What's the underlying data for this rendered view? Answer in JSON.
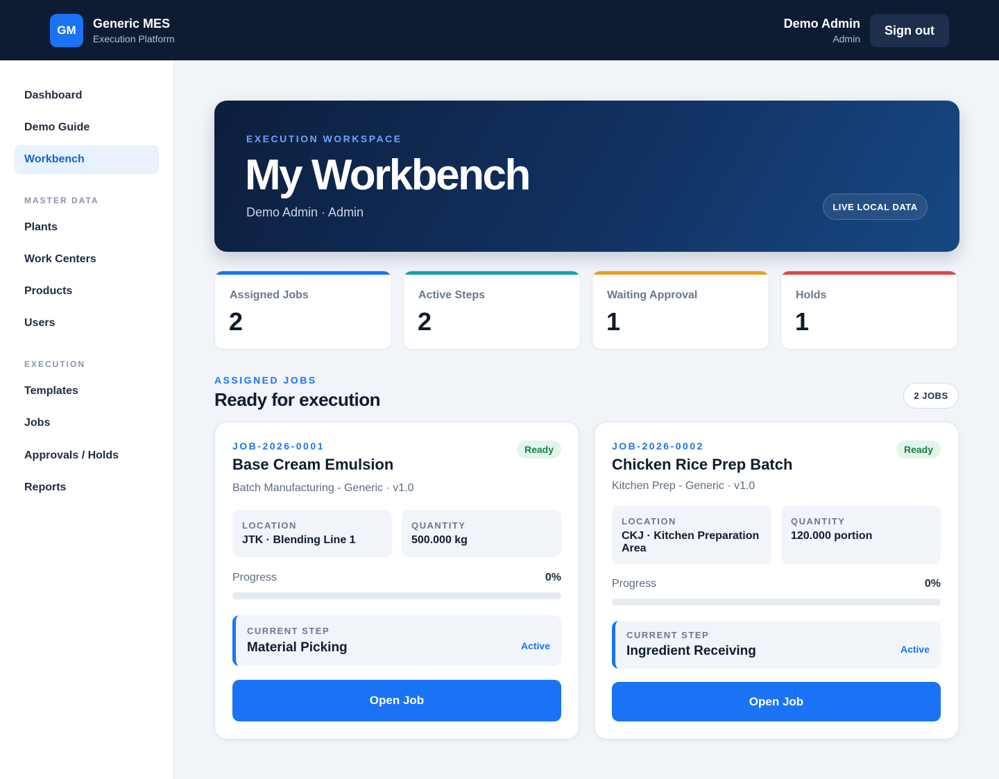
{
  "header": {
    "logo_text": "GM",
    "app_name": "Generic MES",
    "app_subtitle": "Execution Platform",
    "user_name": "Demo Admin",
    "user_role": "Admin",
    "signout_label": "Sign out"
  },
  "sidebar": {
    "items_top": [
      "Dashboard",
      "Demo Guide",
      "Workbench"
    ],
    "active_item": "Workbench",
    "master_data_label": "MASTER DATA",
    "master_items": [
      "Plants",
      "Work Centers",
      "Products",
      "Users"
    ],
    "execution_label": "EXECUTION",
    "execution_items": [
      "Templates",
      "Jobs",
      "Approvals / Holds",
      "Reports"
    ]
  },
  "hero": {
    "eyebrow": "EXECUTION WORKSPACE",
    "title": "My Workbench",
    "subtitle": "Demo Admin · Admin",
    "badge": "LIVE LOCAL DATA"
  },
  "stats": [
    {
      "label": "Assigned Jobs",
      "value": "2",
      "color": "#1a73f5"
    },
    {
      "label": "Active Steps",
      "value": "2",
      "color": "#14a3a8"
    },
    {
      "label": "Waiting Approval",
      "value": "1",
      "color": "#e8a020"
    },
    {
      "label": "Holds",
      "value": "1",
      "color": "#d94a4a"
    }
  ],
  "section": {
    "eyebrow": "ASSIGNED JOBS",
    "title": "Ready for execution",
    "count_badge": "2 JOBS"
  },
  "jobs": [
    {
      "id": "JOB-2026-0001",
      "name": "Base Cream Emulsion",
      "status": "Ready",
      "template": "Batch Manufacturing - Generic · v1.0",
      "location_label": "LOCATION",
      "location": "JTK · Blending Line 1",
      "quantity_label": "QUANTITY",
      "quantity": "500.000 kg",
      "progress_label": "Progress",
      "progress_text": "0%",
      "progress": 0,
      "current_step_label": "CURRENT STEP",
      "current_step": "Material Picking",
      "step_state": "Active",
      "button": "Open Job"
    },
    {
      "id": "JOB-2026-0002",
      "name": "Chicken Rice Prep Batch",
      "status": "Ready",
      "template": "Kitchen Prep - Generic · v1.0",
      "location_label": "LOCATION",
      "location": "CKJ · Kitchen Preparation Area",
      "quantity_label": "QUANTITY",
      "quantity": "120.000 portion",
      "progress_label": "Progress",
      "progress_text": "0%",
      "progress": 0,
      "current_step_label": "CURRENT STEP",
      "current_step": "Ingredient Receiving",
      "step_state": "Active",
      "button": "Open Job"
    }
  ]
}
